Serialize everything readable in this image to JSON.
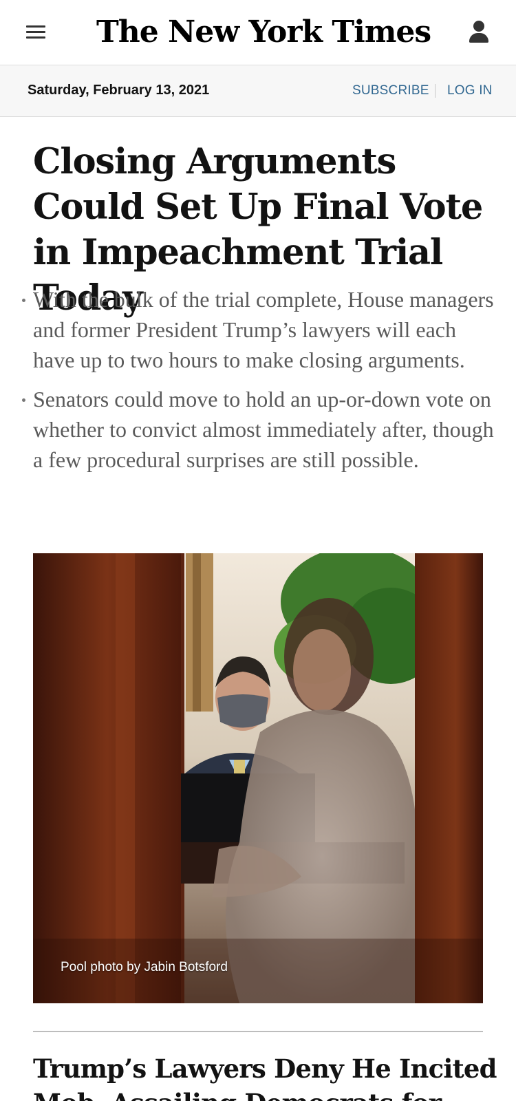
{
  "header": {
    "menu_icon": "hamburger-menu-icon",
    "logo_text": "The New York Times",
    "account_icon": "user-account-icon"
  },
  "datebar": {
    "date": "Saturday, February 13, 2021",
    "subscribe_label": "SUBSCRIBE",
    "login_label": "LOG IN",
    "link_color": "#326891"
  },
  "lead_story": {
    "headline": "Closing Arguments Could Set Up Final Vote in Impeachment Trial Today",
    "summary": [
      "With the bulk of the trial complete, House managers and former President Trump’s lawyers will each have up to two hours to make closing arguments.",
      "Senators could move to hold an up-or-down vote on whether to convict almost immediately after, though a few procedural surprises are still possible."
    ],
    "photo_caption": "Pool photo by Jabin Botsford"
  },
  "next_story": {
    "headline": "Trump’s Lawyers Deny He Incited Mob, Assailing Democrats for"
  }
}
